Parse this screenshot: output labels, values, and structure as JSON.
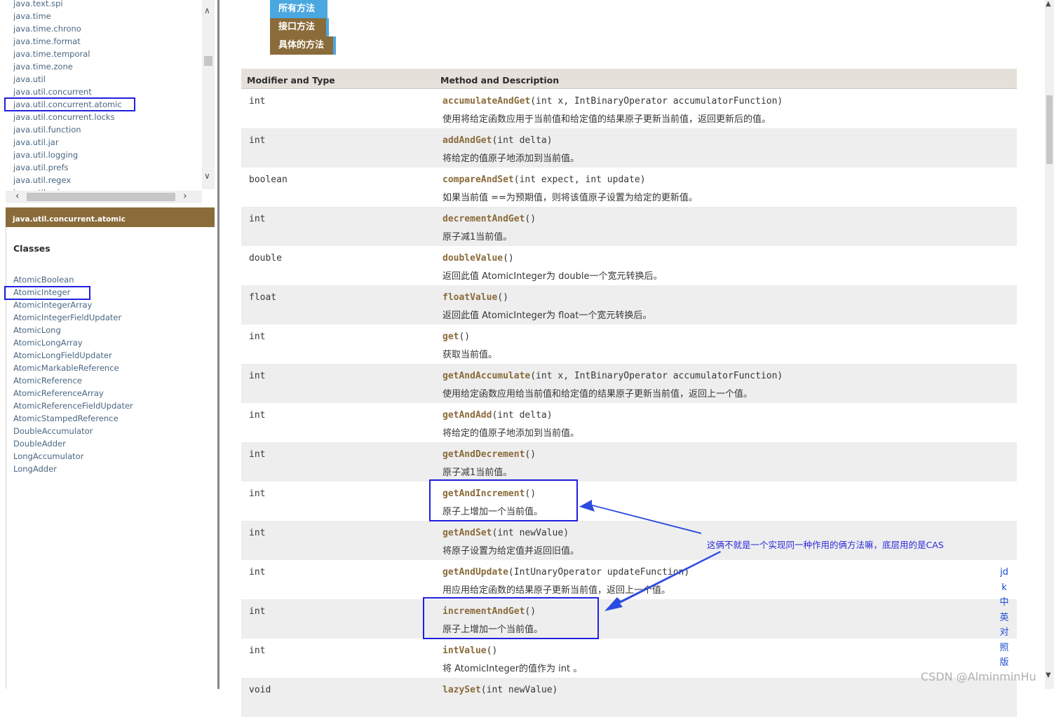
{
  "left_frame": {
    "packages": [
      "java.text.spi",
      "java.time",
      "java.time.chrono",
      "java.time.format",
      "java.time.temporal",
      "java.time.zone",
      "java.util",
      "java.util.concurrent",
      "java.util.concurrent.atomic",
      "java.util.concurrent.locks",
      "java.util.function",
      "java.util.jar",
      "java.util.logging",
      "java.util.prefs",
      "java.util.regex",
      "java.util.spi"
    ],
    "selected_package": "java.util.concurrent.atomic",
    "package_bar_title": "java.util.concurrent.atomic",
    "classes_heading": "Classes",
    "classes": [
      "AtomicBoolean",
      "AtomicInteger",
      "AtomicIntegerArray",
      "AtomicIntegerFieldUpdater",
      "AtomicLong",
      "AtomicLongArray",
      "AtomicLongFieldUpdater",
      "AtomicMarkableReference",
      "AtomicReference",
      "AtomicReferenceArray",
      "AtomicReferenceFieldUpdater",
      "AtomicStampedReference",
      "DoubleAccumulator",
      "DoubleAdder",
      "LongAccumulator",
      "LongAdder"
    ],
    "selected_class": "AtomicInteger"
  },
  "tabs": [
    "所有方法",
    "接口方法",
    "具体的方法"
  ],
  "table": {
    "header_type": "Modifier and Type",
    "header_method": "Method and Description",
    "rows": [
      {
        "type": "int",
        "name": "accumulateAndGet",
        "params": "(int x, IntBinaryOperator accumulatorFunction)",
        "desc": "使用将给定函数应用于当前值和给定值的结果原子更新当前值，返回更新后的值。"
      },
      {
        "type": "int",
        "name": "addAndGet",
        "params": "(int delta)",
        "desc": "将给定的值原子地添加到当前值。"
      },
      {
        "type": "boolean",
        "name": "compareAndSet",
        "params": "(int expect, int update)",
        "desc": "如果当前值 ==为预期值，则将该值原子设置为给定的更新值。"
      },
      {
        "type": "int",
        "name": "decrementAndGet",
        "params": "()",
        "desc": "原子减1当前值。"
      },
      {
        "type": "double",
        "name": "doubleValue",
        "params": "()",
        "desc": "返回此值 AtomicInteger为 double一个宽元转换后。"
      },
      {
        "type": "float",
        "name": "floatValue",
        "params": "()",
        "desc": "返回此值 AtomicInteger为 float一个宽元转换后。"
      },
      {
        "type": "int",
        "name": "get",
        "params": "()",
        "desc": "获取当前值。"
      },
      {
        "type": "int",
        "name": "getAndAccumulate",
        "params": "(int x, IntBinaryOperator accumulatorFunction)",
        "desc": "使用给定函数应用给当前值和给定值的结果原子更新当前值，返回上一个值。"
      },
      {
        "type": "int",
        "name": "getAndAdd",
        "params": "(int delta)",
        "desc": "将给定的值原子地添加到当前值。"
      },
      {
        "type": "int",
        "name": "getAndDecrement",
        "params": "()",
        "desc": "原子减1当前值。"
      },
      {
        "type": "int",
        "name": "getAndIncrement",
        "params": "()",
        "desc": "原子上增加一个当前值。"
      },
      {
        "type": "int",
        "name": "getAndSet",
        "params": "(int newValue)",
        "desc": "将原子设置为给定值并返回旧值。"
      },
      {
        "type": "int",
        "name": "getAndUpdate",
        "params": "(IntUnaryOperator updateFunction)",
        "desc": "用应用给定函数的结果原子更新当前值，返回上一个值。"
      },
      {
        "type": "int",
        "name": "incrementAndGet",
        "params": "()",
        "desc": "原子上增加一个当前值。"
      },
      {
        "type": "int",
        "name": "intValue",
        "params": "()",
        "desc": "将 AtomicInteger的值作为 int 。"
      },
      {
        "type": "void",
        "name": "lazySet",
        "params": "(int newValue)",
        "desc": ""
      }
    ]
  },
  "annotation_text": "这俩不就是一个实现同一种作用的俩方法嘛，底层用的是CAS",
  "jdk_link": "jdk中英对照版",
  "watermark": "CSDN @AlminminHu",
  "colors": {
    "tab_active": "#4aa7e0",
    "tab_inactive": "#8a6b3a",
    "method_name": "#8a6b3a",
    "highlight_box": "#2020e0",
    "link": "#4a6782"
  }
}
